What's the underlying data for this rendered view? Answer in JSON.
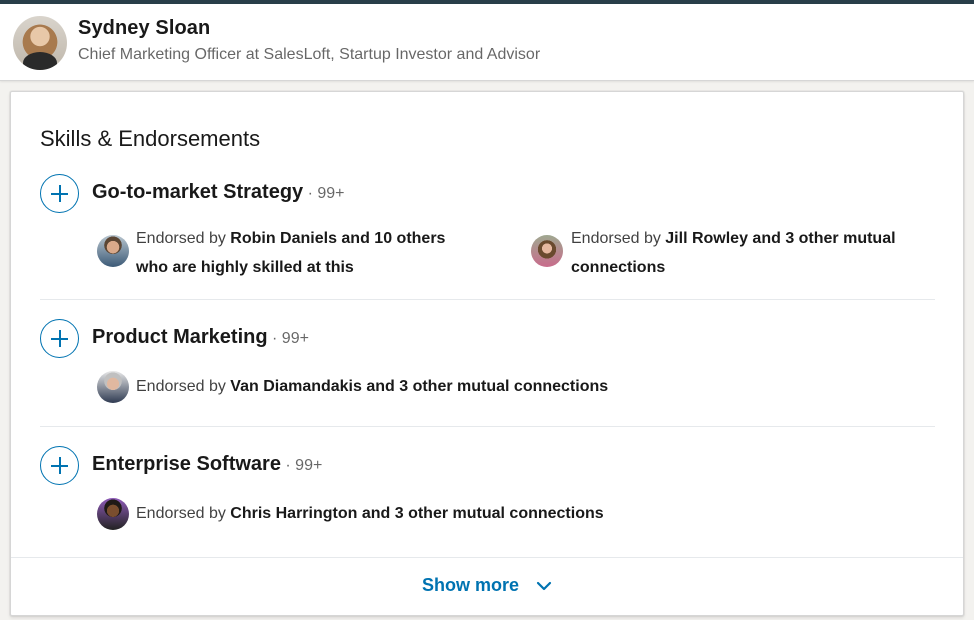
{
  "profile": {
    "name": "Sydney Sloan",
    "headline": "Chief Marketing Officer at SalesLoft, Startup Investor and Advisor"
  },
  "section": {
    "title": "Skills & Endorsements",
    "show_more_label": "Show more"
  },
  "skills": [
    {
      "name": "Go-to-market Strategy",
      "count": " · 99+",
      "endorsements": [
        {
          "prefix": "Endorsed by ",
          "bold": "Robin Daniels and 10 others who are highly skilled at this",
          "avatar": "Robin Daniels"
        },
        {
          "prefix": "Endorsed by ",
          "bold": "Jill Rowley and 3 other mutual connections",
          "avatar": "Jill Rowley"
        }
      ]
    },
    {
      "name": "Product Marketing",
      "count": " · 99+",
      "endorsements": [
        {
          "prefix": "Endorsed by ",
          "bold": "Van Diamandakis and 3 other mutual connections",
          "avatar": "Van Diamandakis"
        }
      ]
    },
    {
      "name": "Enterprise Software",
      "count": " · 99+",
      "endorsements": [
        {
          "prefix": "Endorsed by ",
          "bold": "Chris Harrington and 3 other mutual connections",
          "avatar": "Chris Harrington"
        }
      ]
    }
  ],
  "colors": {
    "accent": "#0073b1",
    "topbar": "#293e49"
  },
  "icons": {
    "endorse": "plus-icon",
    "show_more": "chevron-down-icon"
  }
}
